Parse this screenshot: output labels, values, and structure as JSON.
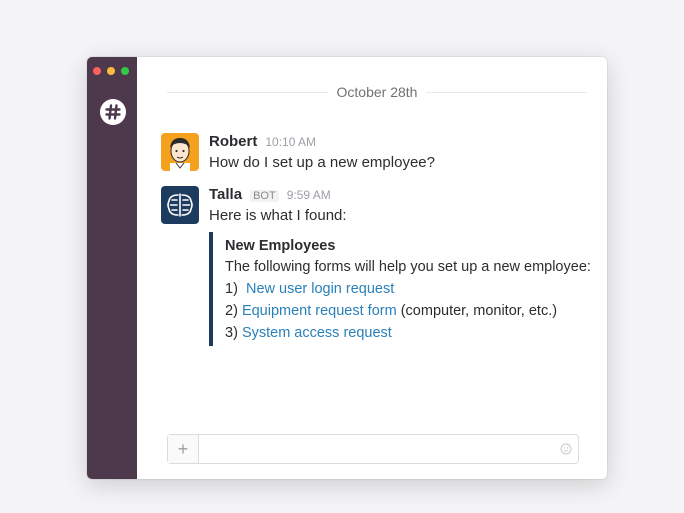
{
  "date_divider": "October 28th",
  "messages": [
    {
      "sender": "Robert",
      "time": "10:10 AM",
      "text": "How do I set up a new employee?",
      "avatar_color": "#f5a11e"
    },
    {
      "sender": "Talla",
      "badge": "BOT",
      "time": "9:59 AM",
      "text": "Here is what I found:",
      "avatar_color": "#1d3a5f"
    }
  ],
  "attachment": {
    "title": "New Employees",
    "intro": "The following forms will help you set up a new employee:",
    "items": [
      {
        "num": "1)",
        "link": "New user login request",
        "suffix": ""
      },
      {
        "num": "2)",
        "link": "Equipment request form",
        "suffix": " (computer, monitor, etc.)"
      },
      {
        "num": "3)",
        "link": "System access request",
        "suffix": ""
      }
    ],
    "bar_color": "#1d3a5f",
    "link_color": "#2a80b9"
  },
  "composer": {
    "plus_label": "+",
    "placeholder": ""
  },
  "colors": {
    "sidebar": "#4d394b",
    "accent_link": "#2a80b9"
  },
  "icons": {
    "team": "slack-hash-icon",
    "composer_add": "plus-icon",
    "composer_emoji": "emoji-icon"
  }
}
